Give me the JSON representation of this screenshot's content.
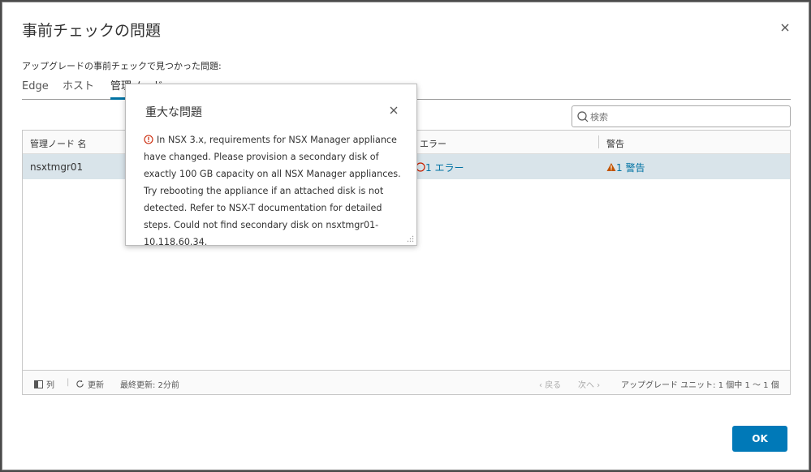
{
  "dialog": {
    "title": "事前チェックの問題",
    "subtitle": "アップグレードの事前チェックで見つかった問題:",
    "ok_label": "OK"
  },
  "tabs": [
    {
      "label": "Edge"
    },
    {
      "label": "ホスト"
    },
    {
      "label": "管理ノード",
      "active": true
    }
  ],
  "search": {
    "placeholder": "検索"
  },
  "grid": {
    "columns": [
      "管理ノード 名",
      "エラー",
      "警告"
    ],
    "rows": [
      {
        "name": "nsxtmgr01",
        "errors": "1 エラー",
        "warnings": "1 警告"
      }
    ],
    "footer": {
      "columns_label": "列",
      "refresh_label": "更新",
      "last_updated": "最終更新: 2分前",
      "prev_label": "戻る",
      "next_label": "次へ",
      "pagination": "アップグレード ユニット: 1 個中 1 ～ 1 個"
    }
  },
  "popover": {
    "title": "重大な問題",
    "message": "In NSX 3.x, requirements for NSX Manager appliance have changed. Please provision a secondary disk of exactly 100 GB capacity on all NSX Manager appliances. Try rebooting the appliance if an attached disk is not detected. Refer to NSX-T documentation for detailed steps. Could not find secondary disk on nsxtmgr01-10.118.60.34."
  },
  "colors": {
    "accent": "#0072a3",
    "button": "#0079b8",
    "error": "#c92100",
    "warning": "#c25400",
    "selected_row": "#d9e4ea"
  }
}
